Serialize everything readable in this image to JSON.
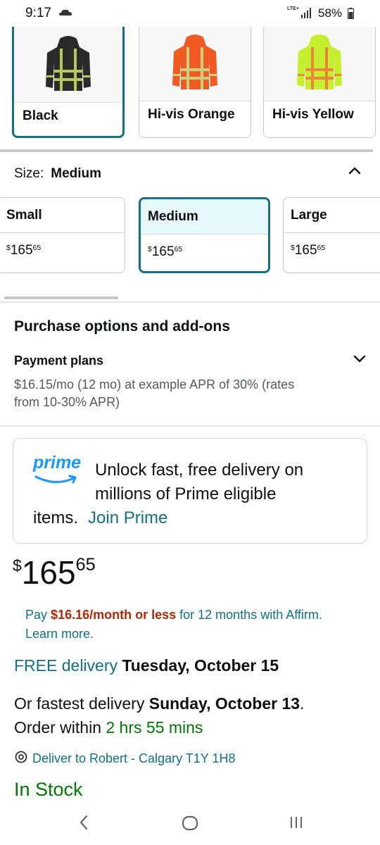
{
  "status_bar": {
    "time": "9:17",
    "network": "LTE+",
    "battery": "58%"
  },
  "colors": [
    {
      "label": "Black",
      "selected": true,
      "jacket_color": "#2b2a2a",
      "stripe_color": "#b8c95a"
    },
    {
      "label": "Hi-vis Orange",
      "selected": false,
      "jacket_color": "#f25a24",
      "stripe_color": "#c9d27a"
    },
    {
      "label": "Hi-vis Yellow",
      "selected": false,
      "jacket_color": "#c8ef2e",
      "stripe_color": "#e8873a"
    }
  ],
  "size": {
    "label": "Size:",
    "value": "Medium",
    "options": [
      {
        "name": "Small",
        "price_currency": "$",
        "price_whole": "165",
        "price_fraction": "65"
      },
      {
        "name": "Medium",
        "price_currency": "$",
        "price_whole": "165",
        "price_fraction": "65",
        "selected": true
      },
      {
        "name": "Large",
        "price_currency": "$",
        "price_whole": "165",
        "price_fraction": "65"
      }
    ]
  },
  "purchase_options": {
    "title": "Purchase options and add-ons",
    "payment_plans_label": "Payment plans",
    "payment_plans_text": "$16.15/mo (12 mo) at example APR of 30% (rates from 10-30% APR)"
  },
  "prime": {
    "logo_text": "prime",
    "message_line": "Unlock fast, free delivery on millions of Prime eligible",
    "message_end": "items.",
    "join_label": "Join Prime"
  },
  "price": {
    "currency": "$",
    "whole": "165",
    "fraction": "65"
  },
  "affirm": {
    "prefix": "Pay",
    "amount": "$16.16/month or less",
    "suffix": "for 12 months with Affirm. Learn more."
  },
  "delivery": {
    "free_label": "FREE delivery",
    "free_date": "Tuesday, October 15",
    "fastest_label": "Or fastest delivery",
    "fastest_date": "Sunday, October 13",
    "order_within_label": "Order within",
    "order_within_time": "2 hrs 55 mins",
    "deliver_to": "Deliver to Robert - Calgary T1Y 1H8"
  },
  "stock": "In Stock",
  "accent_colors": {
    "teal": "#137180",
    "price_red": "#b12704",
    "stock_green": "#007600",
    "prime_blue": "#1a98ff"
  }
}
